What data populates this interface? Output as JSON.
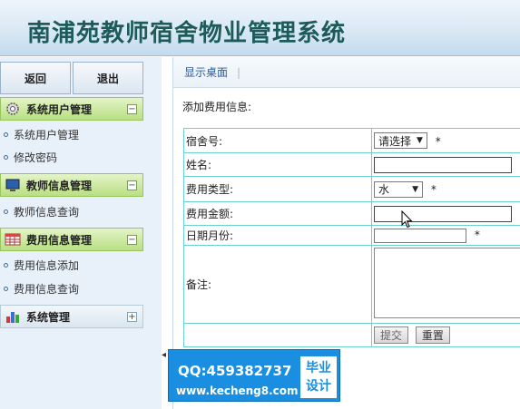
{
  "header": {
    "title": "南浦苑教师宿舍物业管理系统"
  },
  "sidebar": {
    "buttons": {
      "back": "返回",
      "logout": "退出"
    },
    "groups": [
      {
        "label": "系统用户管理",
        "icon": "gear-icon",
        "toggle": "−",
        "items": [
          "系统用户管理",
          "修改密码"
        ]
      },
      {
        "label": "教师信息管理",
        "icon": "monitor-icon",
        "toggle": "−",
        "items": [
          "教师信息查询"
        ]
      },
      {
        "label": "费用信息管理",
        "icon": "calendar-grid-icon",
        "toggle": "−",
        "items": [
          "费用信息添加",
          "费用信息查询"
        ]
      },
      {
        "label": "系统管理",
        "icon": "bar-chart-icon",
        "toggle": "+",
        "items": []
      }
    ],
    "collapse_glyph": "◂"
  },
  "main": {
    "breadcrumb": {
      "current": "显示桌面",
      "separator": "|"
    },
    "section_title": "添加费用信息:",
    "form": {
      "required_mark": "*",
      "dorm_no": {
        "label": "宿舍号:",
        "value": "请选择"
      },
      "name": {
        "label": "姓名:",
        "value": ""
      },
      "fee_type": {
        "label": "费用类型:",
        "value": "水"
      },
      "amount": {
        "label": "费用金额:",
        "value": ""
      },
      "month": {
        "label": "日期月份:",
        "value": ""
      },
      "note": {
        "label": "备注:",
        "value": ""
      },
      "submit": "提交",
      "reset": "重置"
    }
  },
  "watermark": {
    "qq": "QQ:459382737",
    "site": "www.kecheng8.com",
    "tag_line1": "毕业",
    "tag_line2": "设计"
  },
  "colors": {
    "accent": "#1a8ee0",
    "group_header": "#b9df82",
    "table_border": "#6ccfd1"
  }
}
